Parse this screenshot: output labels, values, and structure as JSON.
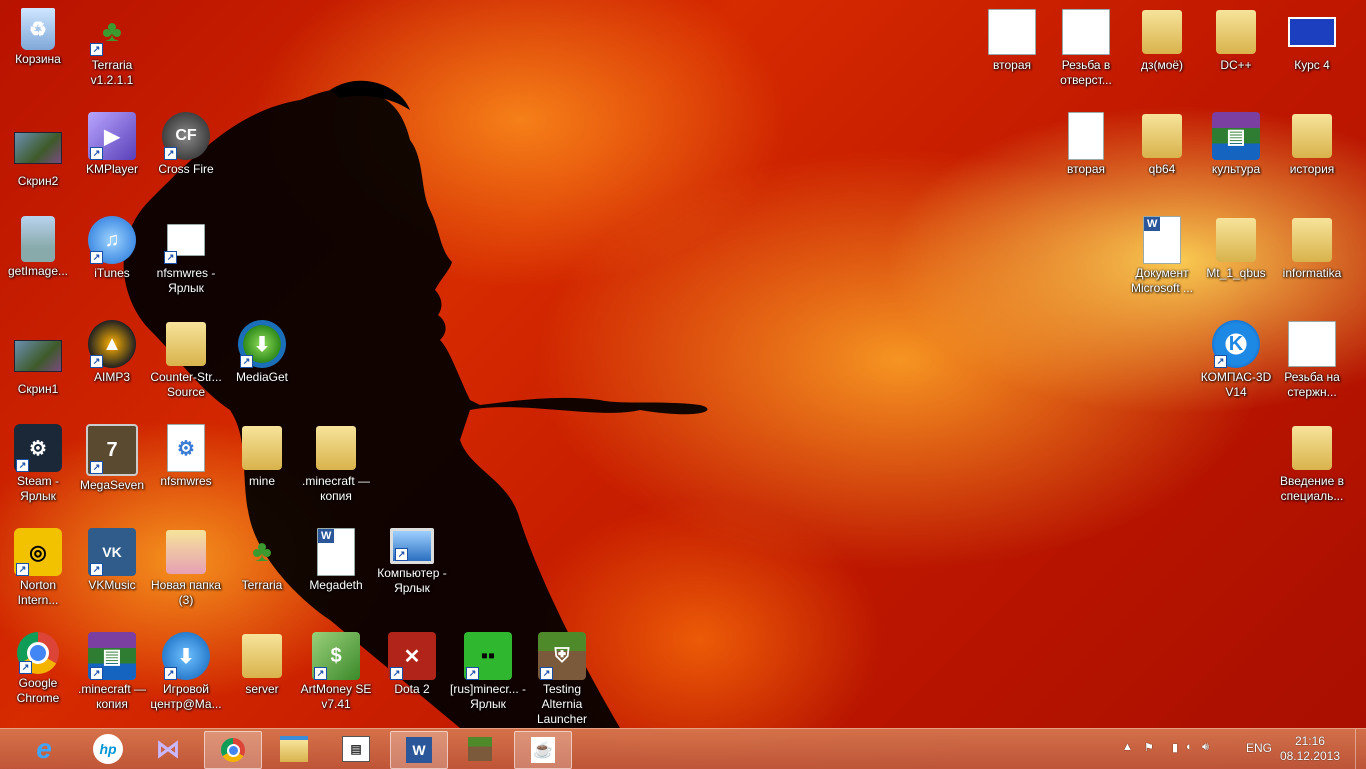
{
  "desktop_icons": {
    "recycle": "Корзина",
    "terraria_ver": "Terraria v1.2.1.1",
    "skrin2": "Скрин2",
    "kmplayer": "KMPlayer",
    "crossfire": "Cross Fire",
    "getimage": "getImage...",
    "itunes": "iTunes",
    "nfsmwres_link": "nfsmwres - Ярлык",
    "skrin1": "Скрин1",
    "aimp3": "AIMP3",
    "counterstrike": "Counter-Str... Source",
    "mediaget": "MediaGet",
    "steam": "Steam - Ярлык",
    "megaseven": "MegaSeven",
    "nfsmwres": "nfsmwres",
    "mine": "mine",
    "minecraft_copy1": ".minecraft — копия",
    "norton": "Norton Intern...",
    "vkmusic": "VKMusic",
    "new_folder3": "Новая папка (3)",
    "terraria": "Terraria",
    "megadeth": "Megadeth",
    "computer_link": "Компьютер - Ярлык",
    "chrome": "Google Chrome",
    "minecraft_copy2": ".minecraft — копия",
    "game_center": "Игровой центр@Ма...",
    "server": "server",
    "artmoney": "ArtMoney SE v7.41",
    "dota2": "Dota 2",
    "rus_minecraft": "[rus]minecr... - Ярлык",
    "alternia": "Testing Alternia Launcher",
    "vtoraya1": "вторая",
    "rezba_otv": "Резьба в отверст...",
    "dz_moe": "дз(моё)",
    "dcpp": "DC++",
    "kurs4": "Курс 4",
    "vtoraya2": "вторая",
    "qb64": "qb64",
    "kultura": "культура",
    "istoriya": "история",
    "doc_microsoft": "Документ Microsoft ...",
    "mt1_qbus": "Mt_1_qbus",
    "informatika": "informatika",
    "kompas": "КОМПАС-3D V14",
    "rezba_sterzh": "Резьба на стержн...",
    "vvedenie": "Введение в специаль..."
  },
  "taskbar": {
    "language": "ENG",
    "time": "21:16",
    "date": "08.12.2013",
    "apps": [
      "internet-explorer",
      "hp",
      "kmplayer",
      "chrome",
      "file-explorer",
      "ms-reader",
      "word",
      "minecraft",
      "java"
    ]
  }
}
